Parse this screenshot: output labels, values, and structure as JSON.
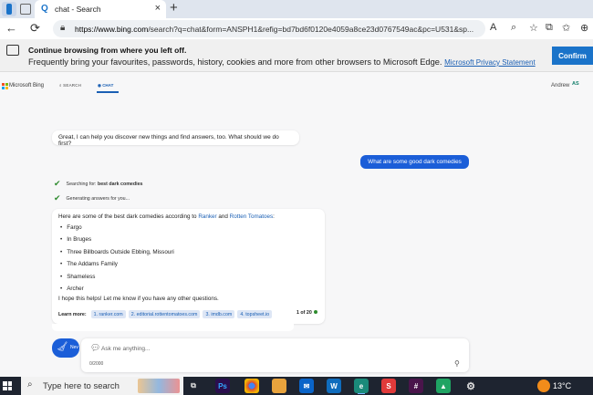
{
  "browser": {
    "tab_title": "chat - Search",
    "url_host": "https://www.bing.com",
    "url_path": "/search?q=chat&form=ANSPH1&refig=bd7bd6f0120e4059a8ce23d0767549ac&pc=U531&sp..."
  },
  "banner": {
    "title": "Continue browsing from where you left off.",
    "text": "Frequently bring your favourites, passwords, history, cookies and more from other browsers to Microsoft Edge.",
    "link": "Microsoft Privacy Statement",
    "confirm_label": "Confirm"
  },
  "bing_header": {
    "brand": "Microsoft Bing",
    "search_label": "SEARCH",
    "chat_label": "CHAT",
    "user_name": "Andrew",
    "user_initials": "AS"
  },
  "chat": {
    "greeting": "Great, I can help you discover new things and find answers, too. What should we do first?",
    "user_message": "What are some good dark comedies",
    "status_search_prefix": "Searching for: ",
    "status_search_term": "best dark comedies",
    "status_generating": "Generating answers for you...",
    "answer": {
      "intro_prefix": "Here are some of the best dark comedies according to ",
      "source_1": "Ranker",
      "intro_and": " and ",
      "source_2": "Rotten Tomatoes",
      "intro_suffix": ":",
      "items": [
        "Fargo",
        "In Bruges",
        "Three Billboards Outside Ebbing, Missouri",
        "The Addams Family",
        "Shameless",
        "Archer"
      ],
      "outro": "I hope this helps! Let me know if you have any other questions.",
      "learn_more_label": "Learn more:",
      "sources": [
        "1. ranker.com",
        "2. editorial.rottentomatoes.com",
        "3. imdb.com",
        "4. topsheet.io"
      ],
      "page_indicator": "1 of 20"
    }
  },
  "input": {
    "new_topic_label": "Nev",
    "placeholder": "Ask me anything...",
    "char_count": "0/2000"
  },
  "taskbar": {
    "search_text": "Type here to search",
    "temperature": "13°C"
  },
  "colors": {
    "accent": "#1b5ed8",
    "confirm": "#1a73c9",
    "check": "#2e8b2e"
  }
}
